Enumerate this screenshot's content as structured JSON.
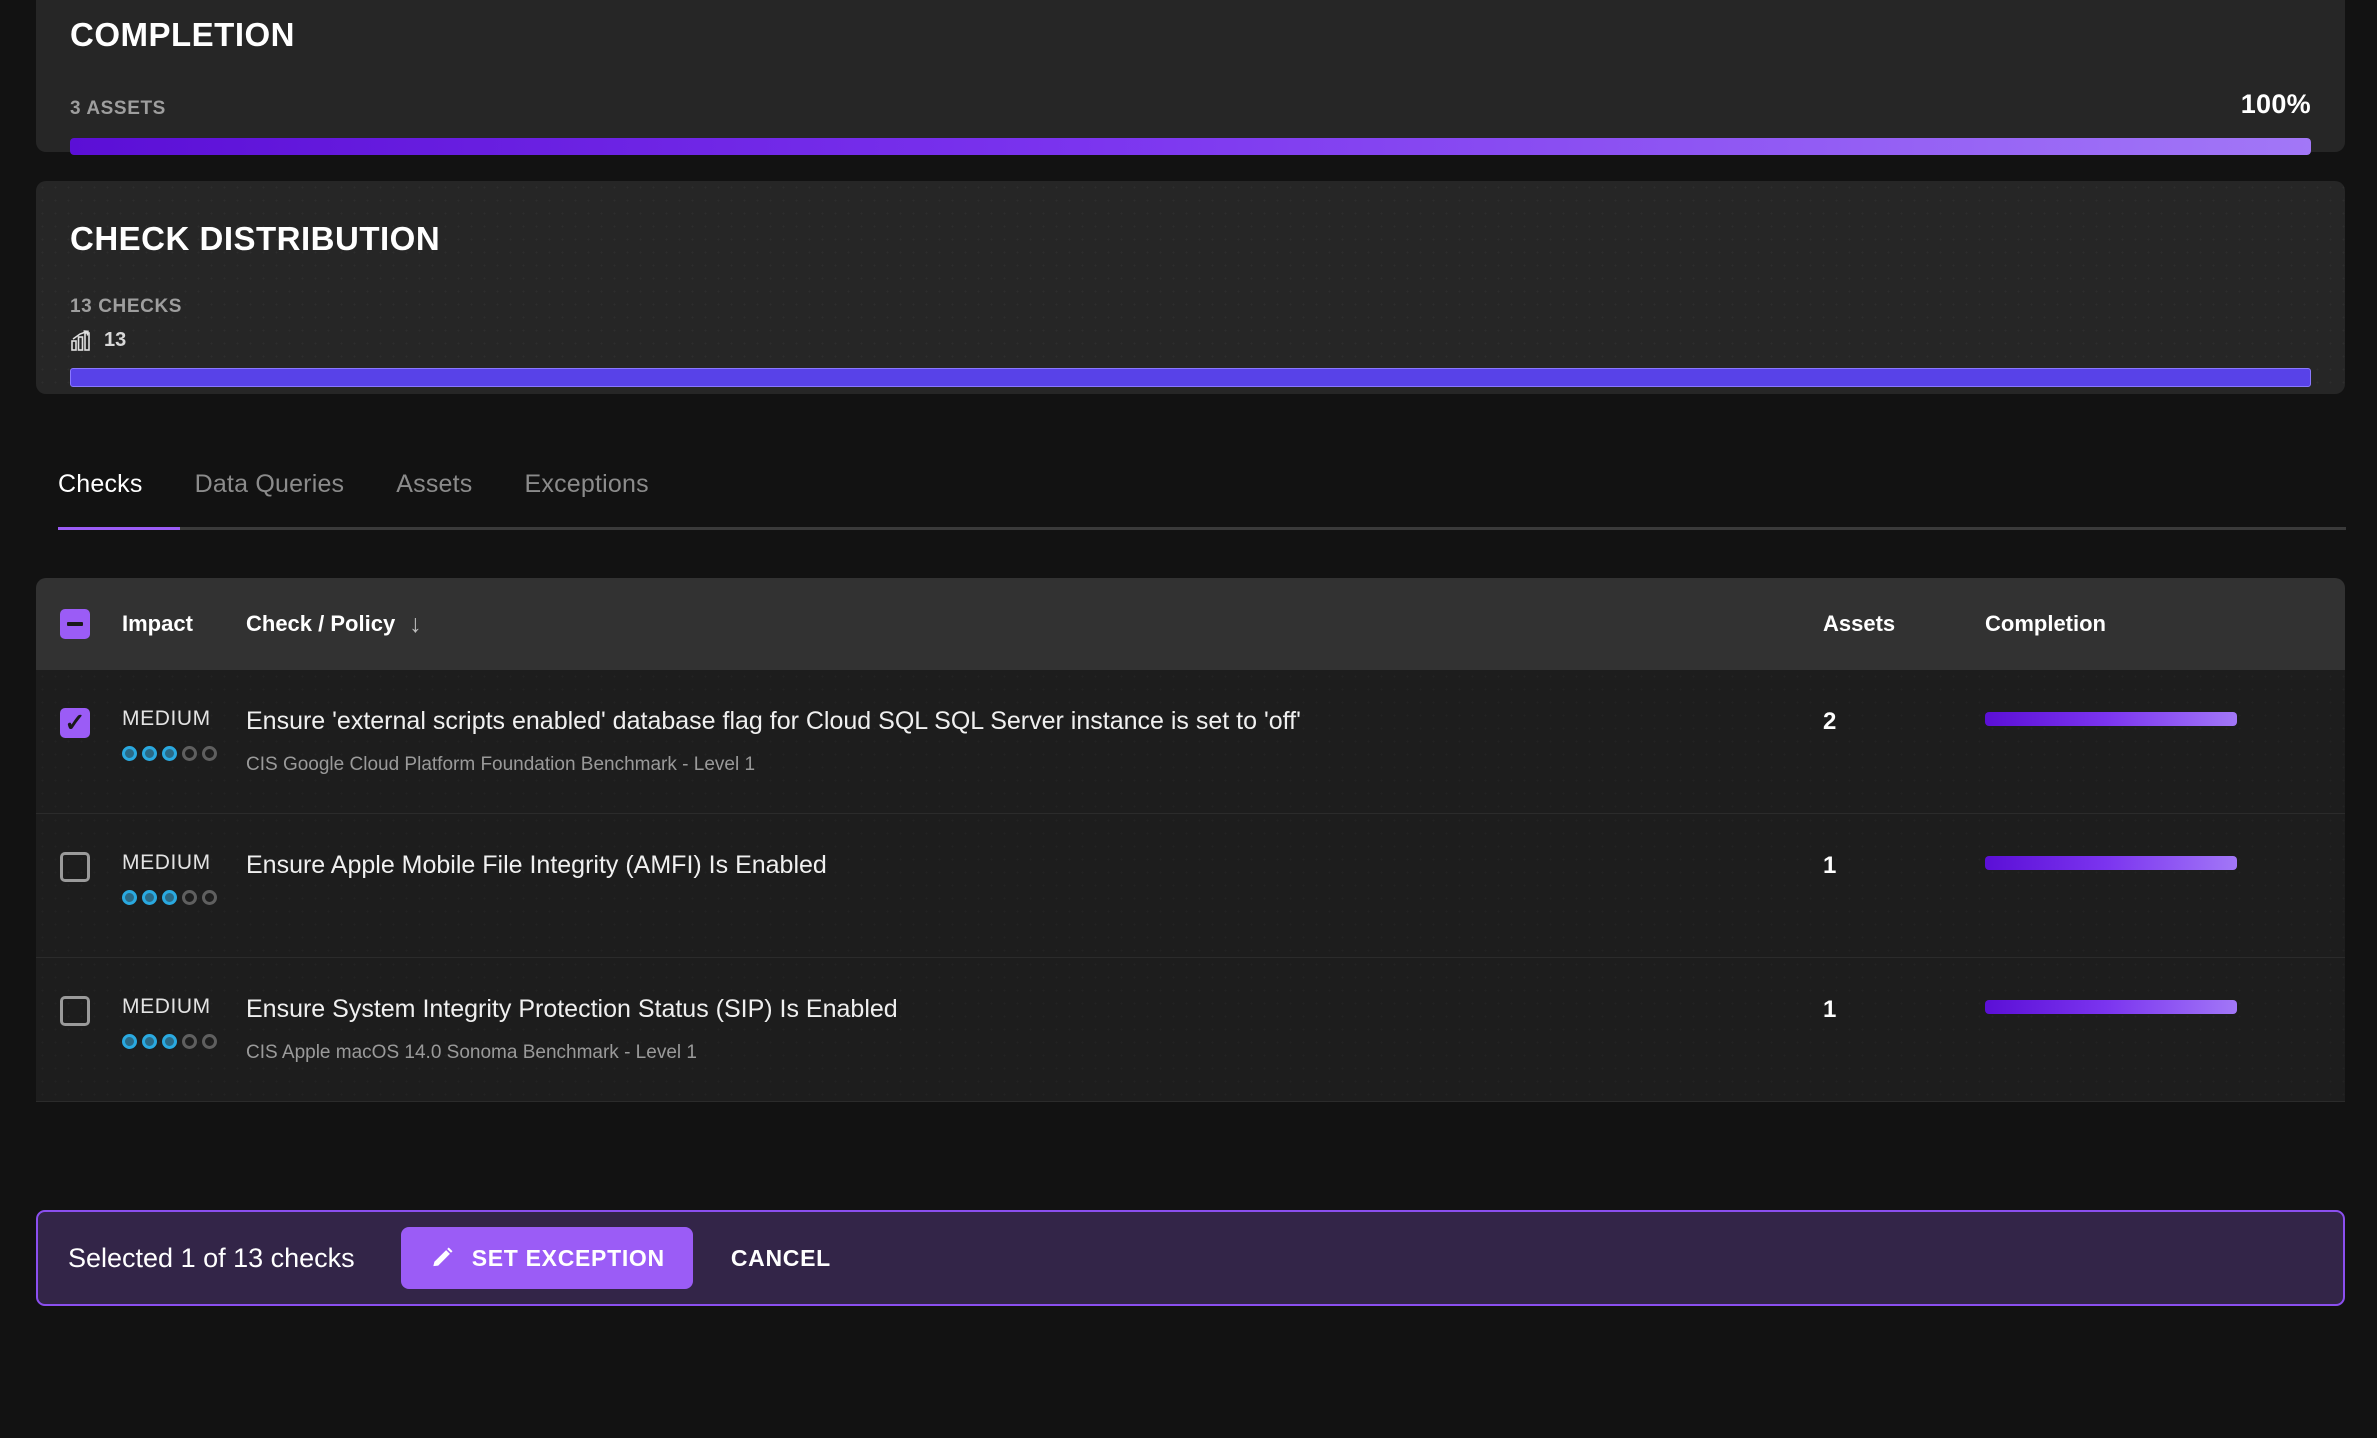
{
  "completion_card": {
    "title": "COMPLETION",
    "assets_label": "3 ASSETS",
    "percent_label": "100%",
    "percent_value": 100
  },
  "distribution_card": {
    "title": "CHECK DISTRIBUTION",
    "checks_label": "13 CHECKS",
    "count_icon": "bar-chart-icon",
    "count_value": "13",
    "bar_color": "#5842e8"
  },
  "tabs": {
    "items": [
      {
        "label": "Checks",
        "active": true
      },
      {
        "label": "Data Queries",
        "active": false
      },
      {
        "label": "Assets",
        "active": false
      },
      {
        "label": "Exceptions",
        "active": false
      }
    ],
    "active_color": "#9b5cf6"
  },
  "table": {
    "header": {
      "select_all_state": "indeterminate",
      "impact": "Impact",
      "policy": "Check / Policy",
      "sort_icon": "arrow-down-icon",
      "assets": "Assets",
      "completion": "Completion"
    },
    "rows": [
      {
        "checked": true,
        "impact": "MEDIUM",
        "impact_dots_filled": 3,
        "impact_dots_total": 5,
        "title": "Ensure 'external scripts enabled' database flag for Cloud SQL SQL Server instance is set to 'off'",
        "subtitle": "CIS Google Cloud Platform Foundation Benchmark - Level 1",
        "assets": "2",
        "completion": 100
      },
      {
        "checked": false,
        "impact": "MEDIUM",
        "impact_dots_filled": 3,
        "impact_dots_total": 5,
        "title": "Ensure Apple Mobile File Integrity (AMFI) Is Enabled",
        "subtitle": "",
        "assets": "1",
        "completion": 100
      },
      {
        "checked": false,
        "impact": "MEDIUM",
        "impact_dots_filled": 3,
        "impact_dots_total": 5,
        "title": "Ensure System Integrity Protection Status (SIP) Is Enabled",
        "subtitle": "CIS Apple macOS 14.0 Sonoma Benchmark - Level 1",
        "assets": "1",
        "completion": 100
      }
    ]
  },
  "action_bar": {
    "status_text": "Selected 1 of 13 checks",
    "primary_icon": "pencil-icon",
    "primary_label": "SET EXCEPTION",
    "secondary_label": "CANCEL",
    "accent_color": "#9b5cf6"
  }
}
